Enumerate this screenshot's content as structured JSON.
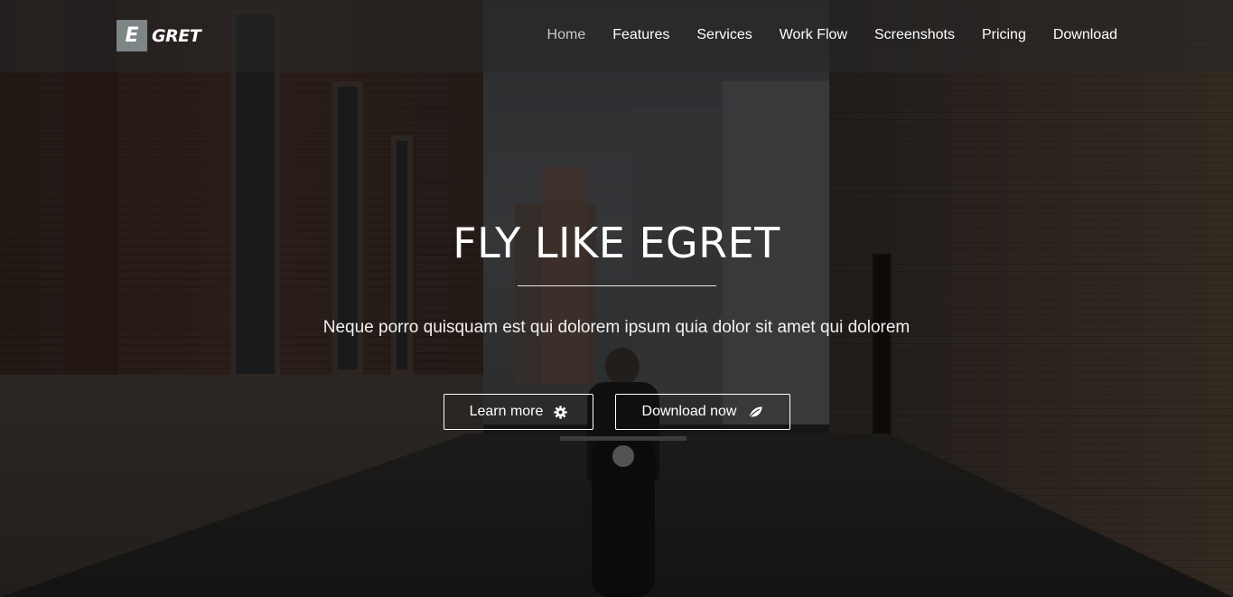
{
  "brand": {
    "logo_letter": "E",
    "logo_text": "GRET",
    "logo_box_color": "#7e8586"
  },
  "nav": {
    "items": [
      {
        "label": "Home",
        "active": true
      },
      {
        "label": "Features",
        "active": false
      },
      {
        "label": "Services",
        "active": false
      },
      {
        "label": "Work Flow",
        "active": false
      },
      {
        "label": "Screenshots",
        "active": false
      },
      {
        "label": "Pricing",
        "active": false
      },
      {
        "label": "Download",
        "active": false
      }
    ]
  },
  "hero": {
    "title": "FLY LIKE EGRET",
    "subtitle": "Neque porro quisquam est qui dolorem ipsum quia dolor sit amet qui dolorem",
    "buttons": {
      "learn_more": {
        "label": "Learn more",
        "icon": "gear-icon"
      },
      "download_now": {
        "label": "Download now",
        "icon": "leaf-icon"
      }
    }
  }
}
